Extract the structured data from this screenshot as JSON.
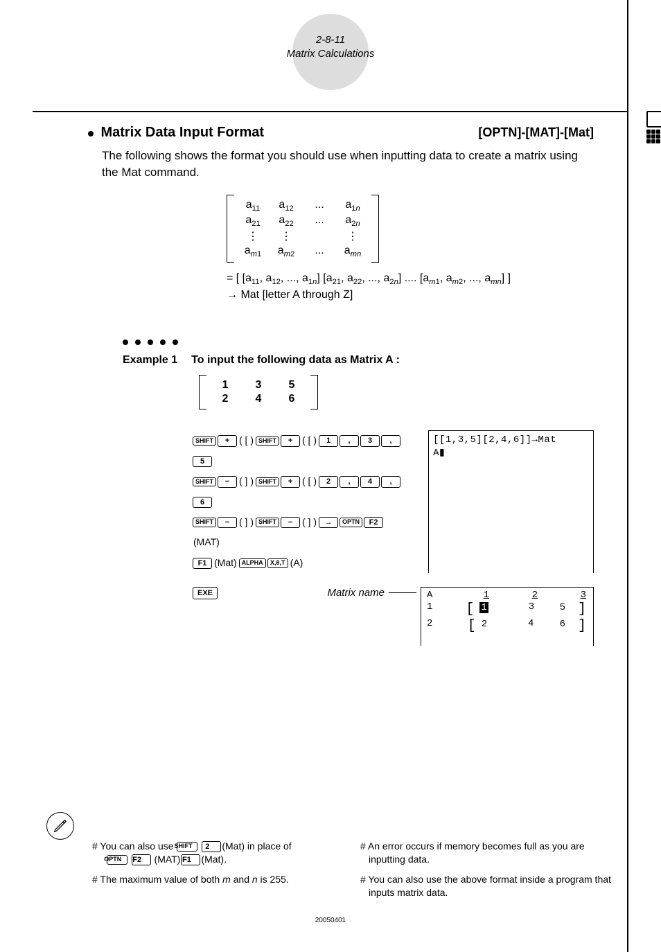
{
  "header": {
    "pageRef": "2-8-11",
    "title": "Matrix Calculations"
  },
  "section": {
    "title": "Matrix Data Input Format",
    "tag": "[OPTN]-[MAT]-[Mat]",
    "intro": "The following shows the format you should use when inputting data to create a matrix using the Mat command."
  },
  "genMatrix": {
    "rows": [
      [
        "a11",
        "a12",
        "...",
        "a1n"
      ],
      [
        "a21",
        "a22",
        "...",
        "a2n"
      ],
      [
        "⋮",
        "⋮",
        "",
        "⋮"
      ],
      [
        "am1",
        "am2",
        "...",
        "amn"
      ]
    ],
    "eq": "= [ [a11, a12, ..., a1n] [a21, a22, ..., a2n] .... [am1, am2, ..., amn] ]",
    "arrow": "→ Mat [letter A through Z]"
  },
  "example": {
    "label": "Example 1",
    "text": "To input the following data as Matrix A :",
    "matrix": [
      [
        "1",
        "3",
        "5"
      ],
      [
        "2",
        "4",
        "6"
      ]
    ]
  },
  "keyLines": {
    "l1_label_mat": "(MAT)",
    "l4_f1": "(Mat)",
    "l4_a": "(A)"
  },
  "screen1": {
    "l1": "[[1,3,5][2,4,6]]→Mat",
    "l2": "A▮"
  },
  "exeRow": {
    "matrixNameLabel": "Matrix name"
  },
  "screen2": {
    "name": "A",
    "cols": [
      "1",
      "2",
      "3"
    ],
    "r1": [
      "1",
      "1",
      "3",
      "5"
    ],
    "r2": [
      "2",
      "2",
      "4",
      "6"
    ]
  },
  "footnotes": {
    "left1a": "# You can also use ",
    "left1b": "(Mat) in place of",
    "left1c": " (MAT)",
    "left1d": "(Mat).",
    "left2": "# The maximum value of both m and n is 255.",
    "right1": "# An error occurs if memory becomes full as you are inputting data.",
    "right2": "# You can also use the above format inside a program that inputs matrix data."
  },
  "footDate": "20050401",
  "keys": {
    "shift": "SHIFT",
    "plus": "+",
    "minus": "−",
    "arrow": "→",
    "optn": "OPTN",
    "f1": "F1",
    "f2": "F2",
    "alpha": "ALPHA",
    "xot": "X,θ,T",
    "exe": "EXE",
    "comma": ",",
    "n1": "1",
    "n2": "2",
    "n3": "3",
    "n4": "4",
    "n5": "5",
    "n6": "6"
  }
}
